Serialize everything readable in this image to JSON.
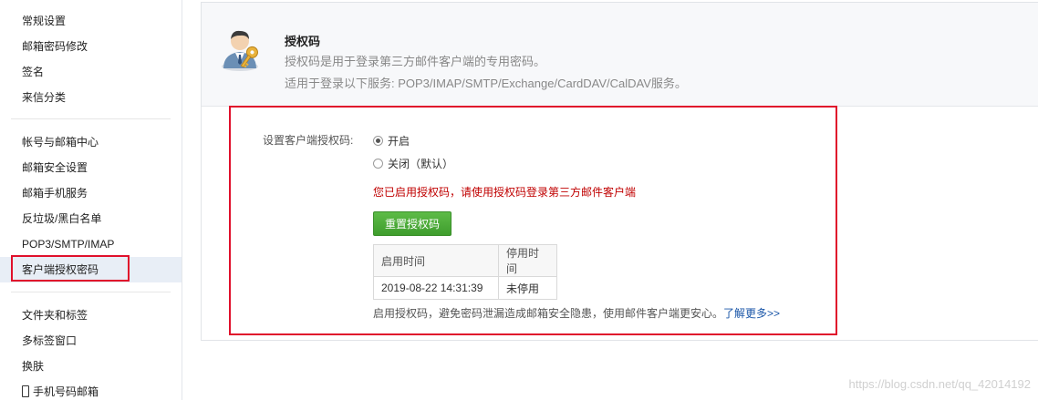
{
  "sidebar": {
    "group1": [
      {
        "id": "general",
        "label": "常规设置"
      },
      {
        "id": "password",
        "label": "邮箱密码修改"
      },
      {
        "id": "signature",
        "label": "签名"
      },
      {
        "id": "filter",
        "label": "来信分类"
      }
    ],
    "group2": [
      {
        "id": "account",
        "label": "帐号与邮箱中心"
      },
      {
        "id": "security",
        "label": "邮箱安全设置"
      },
      {
        "id": "mobile",
        "label": "邮箱手机服务"
      },
      {
        "id": "spam",
        "label": "反垃圾/黑白名单"
      },
      {
        "id": "pop3",
        "label": "POP3/SMTP/IMAP"
      },
      {
        "id": "clientauth",
        "label": "客户端授权密码",
        "active": true
      }
    ],
    "group3": [
      {
        "id": "folders",
        "label": "文件夹和标签"
      },
      {
        "id": "tabs",
        "label": "多标签窗口"
      },
      {
        "id": "skin",
        "label": "换肤"
      },
      {
        "id": "phonemail",
        "label": "手机号码邮箱"
      }
    ]
  },
  "header": {
    "title": "授权码",
    "description": "授权码是用于登录第三方邮件客户端的专用密码。",
    "services": "适用于登录以下服务: POP3/IMAP/SMTP/Exchange/CardDAV/CalDAV服务。",
    "icon": "user-key-icon"
  },
  "settings": {
    "label": "设置客户端授权码:",
    "option_on": "开启",
    "option_off": "关闭（默认）",
    "selected": "on",
    "status_message": "您已启用授权码，请使用授权码登录第三方邮件客户端",
    "reset_button": "重置授权码"
  },
  "table": {
    "headers": [
      "启用时间",
      "停用时间"
    ],
    "rows": [
      [
        "2019-08-22 14:31:39",
        "未停用"
      ]
    ]
  },
  "footer": {
    "note": "启用授权码，避免密码泄漏造成邮箱安全隐患，使用邮件客户端更安心。",
    "link": "了解更多>>"
  },
  "watermark": "https://blog.csdn.net/qq_42014192",
  "colors": {
    "highlight": "#e0102b",
    "status": "#c00000",
    "button": "#4caf37",
    "link": "#1a56a8"
  }
}
